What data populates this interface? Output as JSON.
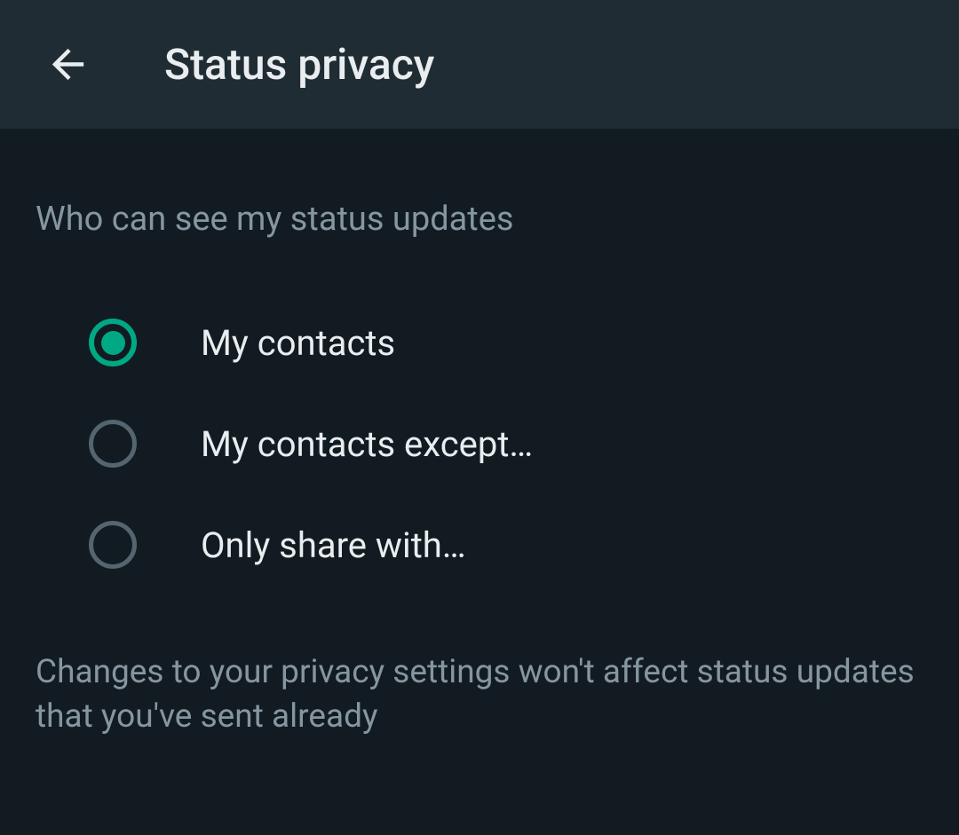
{
  "header": {
    "title": "Status privacy"
  },
  "section": {
    "heading": "Who can see my status updates"
  },
  "options": [
    {
      "label": "My contacts",
      "selected": true
    },
    {
      "label": "My contacts except…",
      "selected": false
    },
    {
      "label": "Only share with…",
      "selected": false
    }
  ],
  "footer": {
    "text": "Changes to your privacy settings won't affect status updates that you've sent already"
  }
}
